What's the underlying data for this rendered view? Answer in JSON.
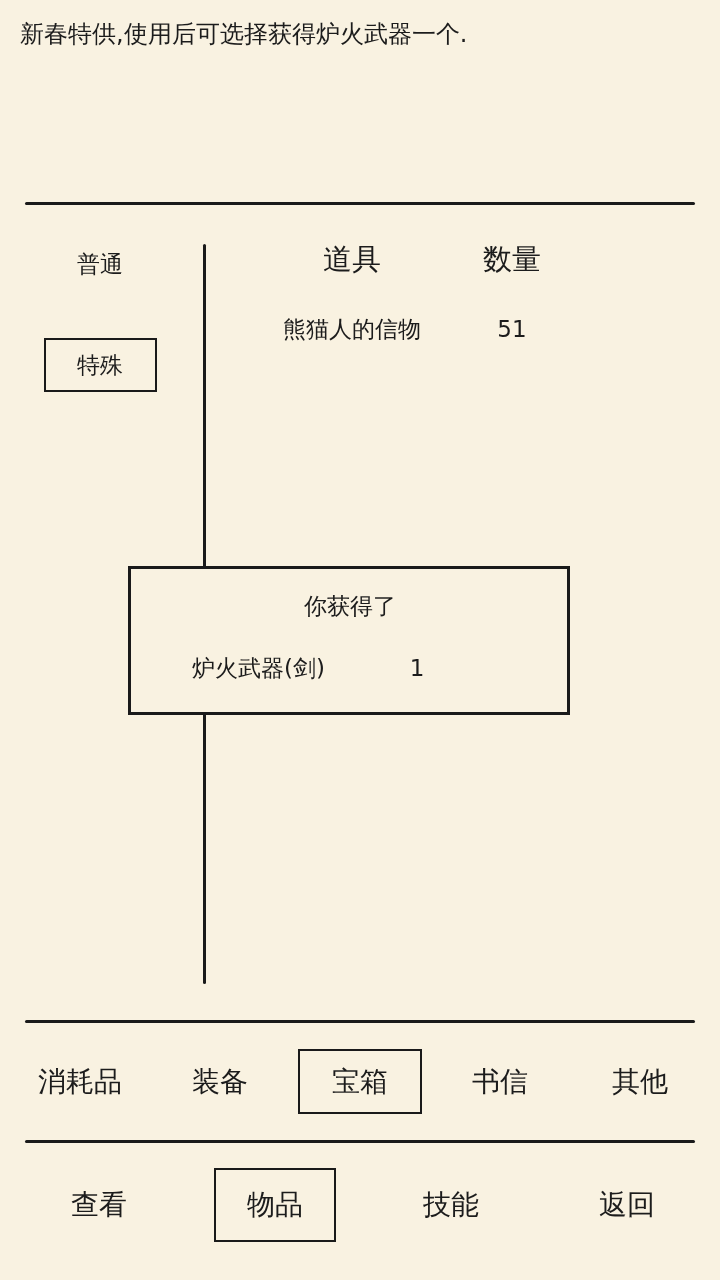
{
  "description": "新春特供,使用后可选择获得炉火武器一个.",
  "categories": [
    {
      "label": "普通",
      "selected": false
    },
    {
      "label": "特殊",
      "selected": true
    }
  ],
  "table": {
    "columns": [
      "道具",
      "数量"
    ],
    "rows": [
      {
        "name": "熊猫人的信物",
        "count": "51"
      }
    ]
  },
  "dialog": {
    "title": "你获得了",
    "items": [
      {
        "name": "炉火武器(剑)",
        "count": "1"
      }
    ]
  },
  "item_tabs": [
    {
      "label": "消耗品",
      "selected": false
    },
    {
      "label": "装备",
      "selected": false
    },
    {
      "label": "宝箱",
      "selected": true
    },
    {
      "label": "书信",
      "selected": false
    },
    {
      "label": "其他",
      "selected": false
    }
  ],
  "nav": [
    {
      "label": "查看",
      "selected": false
    },
    {
      "label": "物品",
      "selected": true
    },
    {
      "label": "技能",
      "selected": false
    },
    {
      "label": "返回",
      "selected": false
    }
  ]
}
